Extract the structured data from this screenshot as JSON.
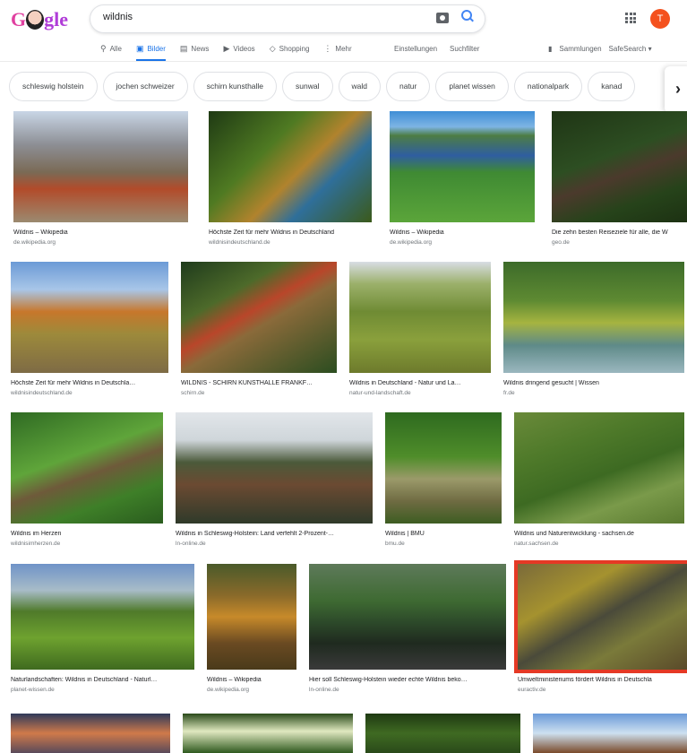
{
  "header": {
    "logo_text_a": "G",
    "logo_text_b": "gle",
    "search_value": "wildnis",
    "avatar_letter": "T"
  },
  "tabs": [
    {
      "icon": "search-icon",
      "glyph": "⚲",
      "label": "Alle"
    },
    {
      "icon": "image-icon",
      "glyph": "▣",
      "label": "Bilder",
      "active": true
    },
    {
      "icon": "news-icon",
      "glyph": "▤",
      "label": "News"
    },
    {
      "icon": "video-icon",
      "glyph": "▶",
      "label": "Videos"
    },
    {
      "icon": "tag-icon",
      "glyph": "◇",
      "label": "Shopping"
    },
    {
      "icon": "more-icon",
      "glyph": "⋮",
      "label": "Mehr"
    }
  ],
  "tools": {
    "settings": "Einstellungen",
    "filter": "Suchfilter",
    "collections": "Sammlungen",
    "safesearch": "SafeSearch ▾"
  },
  "chips": [
    "schleswig holstein",
    "jochen schweizer",
    "schirn kunsthalle",
    "sunwal",
    "wald",
    "natur",
    "planet wissen",
    "nationalpark",
    "kanad"
  ],
  "results": [
    {
      "caption": "Wildnis – Wikipedia",
      "source": "de.wikipedia.org"
    },
    {
      "caption": "Höchste Zeit für mehr Wildnis in Deutschland",
      "source": "wildnisindeutschland.de"
    },
    {
      "caption": "Wildnis – Wikipedia",
      "source": "de.wikipedia.org"
    },
    {
      "caption": "Die zehn besten Reiseziele für alle, die W",
      "source": "geo.de"
    },
    {
      "caption": "Höchste Zeit für mehr Wildnis in Deutschla…",
      "source": "wildnisindeutschland.de"
    },
    {
      "caption": "WILDNIS - SCHIRN KUNSTHALLE FRANKF…",
      "source": "schirn.de"
    },
    {
      "caption": "Wildnis in Deutschland - Natur und La…",
      "source": "natur-und-landschaft.de"
    },
    {
      "caption": "Wildnis dringend gesucht | Wissen",
      "source": "fr.de"
    },
    {
      "caption": "Wildnis im Herzen",
      "source": "wildnisimherzen.de"
    },
    {
      "caption": "Wildnis in Schleswig-Holstein: Land verfehlt 2-Prozent-…",
      "source": "ln-online.de"
    },
    {
      "caption": "Wildnis | BMU",
      "source": "bmu.de"
    },
    {
      "caption": "Wildnis und Naturentwicklung - sachsen.de",
      "source": "natur.sachsen.de"
    },
    {
      "caption": "Naturlandschaften: Wildnis in Deutschland - Naturl…",
      "source": "planet-wissen.de"
    },
    {
      "caption": "Wildnis – Wikipedia",
      "source": "de.wikipedia.org"
    },
    {
      "caption": "Hier soll Schleswig-Holstein wieder echte Wildnis beko…",
      "source": "ln-online.de"
    },
    {
      "caption": "Umweltministeriums fördert Wildnis in Deutschla",
      "source": "euractiv.de"
    },
    {
      "caption": "",
      "source": ""
    },
    {
      "caption": "",
      "source": ""
    },
    {
      "caption": "",
      "source": ""
    },
    {
      "caption": "",
      "source": ""
    }
  ],
  "colors": {
    "accent": "#1a73e8",
    "selected": "#e53925",
    "avatar": "#f4511e"
  }
}
